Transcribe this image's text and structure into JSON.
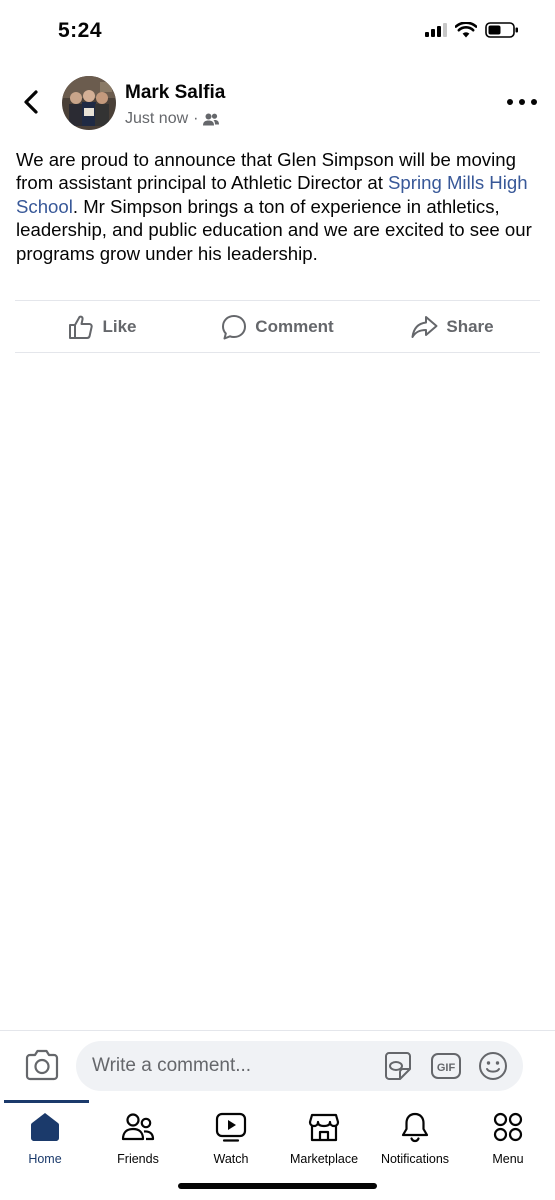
{
  "status_bar": {
    "time": "5:24",
    "signal_icon": "cellular-signal-icon",
    "wifi_icon": "wifi-icon",
    "battery_icon": "battery-icon"
  },
  "post": {
    "author": "Mark Salfia",
    "timestamp": "Just now",
    "separator": "·",
    "audience_icon": "friends-audience-icon",
    "body_part1": "We are proud to announce that Glen Simpson will be moving from assistant principal to Athletic Director at ",
    "body_link": "Spring Mills High School",
    "body_part2": ".  Mr Simpson brings a ton of experience in athletics, leadership, and public education and we are excited to see our programs grow under his leadership.",
    "link_color": "#385898"
  },
  "actions": {
    "like": "Like",
    "comment": "Comment",
    "share": "Share"
  },
  "composer": {
    "placeholder": "Write a comment...",
    "gif_label": "GIF"
  },
  "tabs": [
    {
      "label": "Home",
      "icon": "home-icon",
      "active": true
    },
    {
      "label": "Friends",
      "icon": "friends-icon",
      "active": false
    },
    {
      "label": "Watch",
      "icon": "watch-icon",
      "active": false
    },
    {
      "label": "Marketplace",
      "icon": "marketplace-icon",
      "active": false
    },
    {
      "label": "Notifications",
      "icon": "bell-icon",
      "active": false
    },
    {
      "label": "Menu",
      "icon": "menu-grid-icon",
      "active": false
    }
  ],
  "colors": {
    "accent": "#1b3a6b",
    "secondary_text": "#65676b",
    "divider": "#e4e6eb",
    "input_bg": "#f0f2f5"
  }
}
